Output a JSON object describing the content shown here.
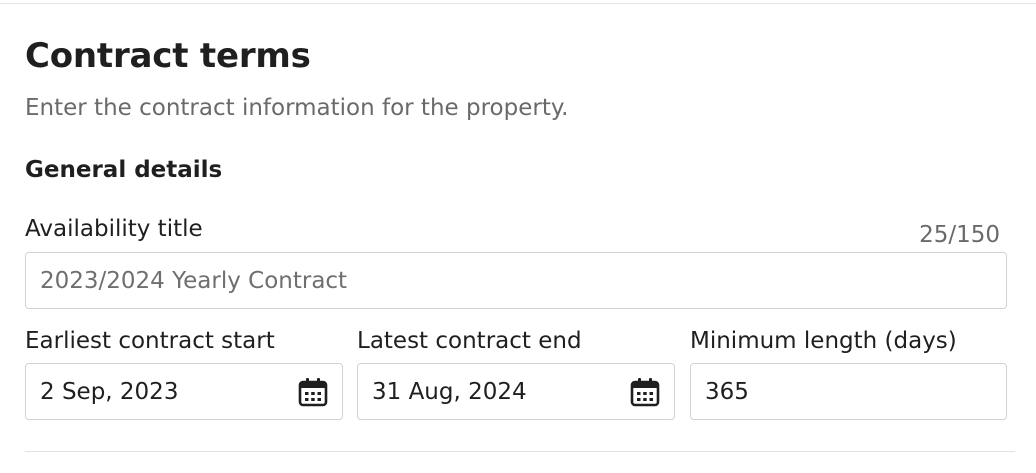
{
  "header": {
    "title": "Contract terms",
    "subtitle": "Enter the contract information for the property."
  },
  "general": {
    "heading": "General details",
    "availability_title": {
      "label": "Availability title",
      "counter": "25/150",
      "placeholder": "2023/2024 Yearly Contract"
    },
    "earliest_start": {
      "label": "Earliest contract start",
      "value": "2 Sep, 2023",
      "icon": "calendar-icon"
    },
    "latest_end": {
      "label": "Latest contract end",
      "value": "31 Aug, 2024",
      "icon": "calendar-icon"
    },
    "minimum_length": {
      "label": "Minimum length (days)",
      "value": "365"
    }
  },
  "colors": {
    "text": "#1f1f1f",
    "muted": "#6a6a6a",
    "border": "#d2d2d2"
  }
}
